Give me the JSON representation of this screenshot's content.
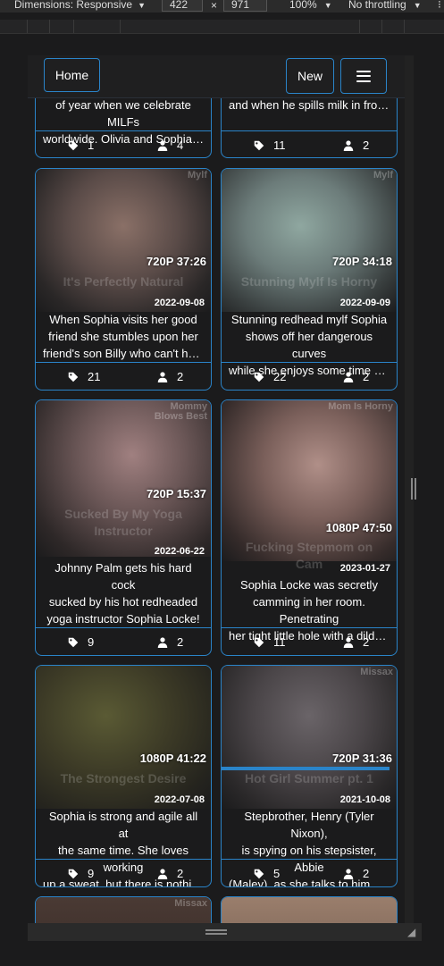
{
  "devtools": {
    "dimensions_label": "Dimensions: Responsive",
    "width": "422",
    "times": "×",
    "height": "971",
    "zoom": "100%",
    "throttle": "No throttling"
  },
  "nav": {
    "home": "Home",
    "new": "New"
  },
  "cards": [
    {
      "desc_lines": [
        "of year when we celebrate MILFs",
        "worldwide. Olivia and Sophia ar..."
      ],
      "tags": "1",
      "performers": "4"
    },
    {
      "desc_lines": [
        "and when he spills milk in front ..."
      ],
      "tags": "11",
      "performers": "2"
    },
    {
      "studio": "Mylf",
      "quality": "720P 37:26",
      "title": "It's Perfectly Natural",
      "date": "2022-09-08",
      "desc_lines": [
        "When Sophia visits her good",
        "friend she stumbles upon her",
        "friend's son Billy who can't help..."
      ],
      "tags": "21",
      "performers": "2"
    },
    {
      "studio": "Mylf",
      "quality": "720P 34:18",
      "title": "Stunning Mylf Is Horny",
      "date": "2022-09-09",
      "desc_lines": [
        "Stunning redhead mylf Sophia",
        "shows off her dangerous curves",
        "while she enjoys some time by t..."
      ],
      "tags": "22",
      "performers": "2"
    },
    {
      "studio": "Mommy Blows Best",
      "quality": "720P 15:37",
      "title": "Sucked By My Yoga Instructor",
      "date": "2022-06-22",
      "desc_lines": [
        "Johnny Palm gets his hard cock",
        "sucked by his hot redheaded",
        "yoga instructor Sophia Locke!"
      ],
      "tags": "9",
      "performers": "2"
    },
    {
      "studio": "Mom Is Horny",
      "quality": "1080P 47:50",
      "title": "Fucking Stepmom on Cam",
      "date": "2023-01-27",
      "desc_lines": [
        "Sophia Locke was secretly",
        "camming in her room. Penetrating",
        "her tight little hole with a dildo..."
      ],
      "tags": "11",
      "performers": "2"
    },
    {
      "studio": "",
      "quality": "1080P 41:22",
      "title": "The Strongest Desire",
      "date": "2022-07-08",
      "desc_lines": [
        "Sophia is strong and agile all at",
        "the same time. She loves working",
        "up a sweat, but there is nothing..."
      ],
      "tags": "9",
      "performers": "2"
    },
    {
      "studio": "Missax",
      "quality": "720P 31:36",
      "title": "Hot Girl Summer pt. 1",
      "date": "2021-10-08",
      "desc_lines": [
        "Stepbrother, Henry (Tyler Nixon),",
        "is spying on his stepsister, Abbie",
        "(Maley), as she talks to him abo..."
      ],
      "tags": "5",
      "performers": "2",
      "progress": 0.96
    },
    {
      "studio": "Missax"
    },
    {
      "studio": ""
    }
  ],
  "colors": {
    "accent": "#2a84c9",
    "background": "#1b1b1c"
  }
}
